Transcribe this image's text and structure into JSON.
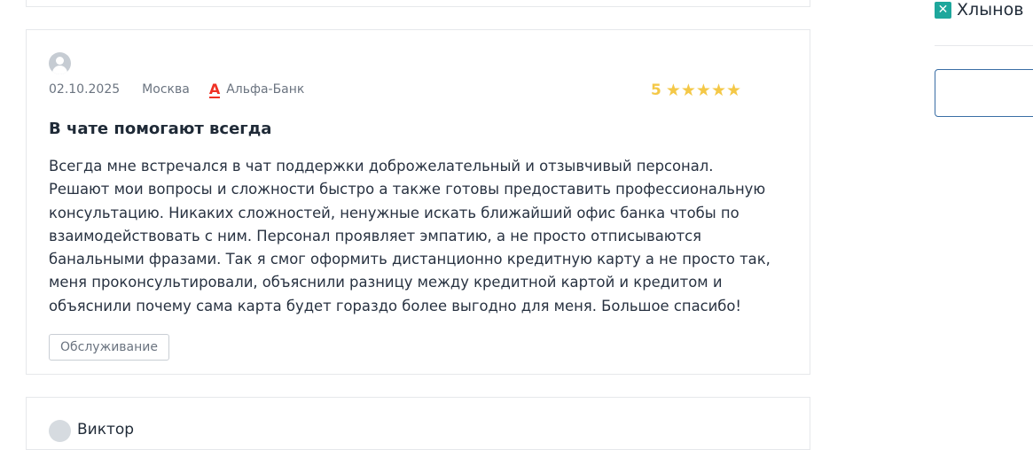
{
  "review": {
    "date": "02.10.2025",
    "city": "Москва",
    "bank_name": "Альфа-Банк",
    "bank_logo_letter": "А",
    "rating": "5",
    "stars": "★★★★★",
    "title": "В чате помогают всегда",
    "text": "Всегда мне встречался в чат поддержки доброжелательный и отзывчивый персонал. Решают мои вопросы и сложности быстро а также готовы предоставить профессиональную консультацию. Никаких сложностей, ненужные искать ближайший офис банка чтобы по взаимодействовать с ним. Персонал проявляет эмпатию, а не просто отписываются банальными фразами. Так я смог оформить дистанционно кредитную карту а не просто так, меня проконсультировали, объяснили разницу между кредитной картой и кредитом и объяснили почему сама карта будет гораздо более выгодно для меня. Большое спасибо!",
    "tag": "Обслуживание"
  },
  "next_review": {
    "author": "Виктор"
  },
  "sidebar": {
    "item_label": "Хлынов",
    "item_icon": "x-logo-icon"
  },
  "colors": {
    "star": "#f4c847",
    "bank_red": "#ef3124",
    "sidebar_icon": "#1ea79c",
    "box_border": "#3a6ea5"
  }
}
